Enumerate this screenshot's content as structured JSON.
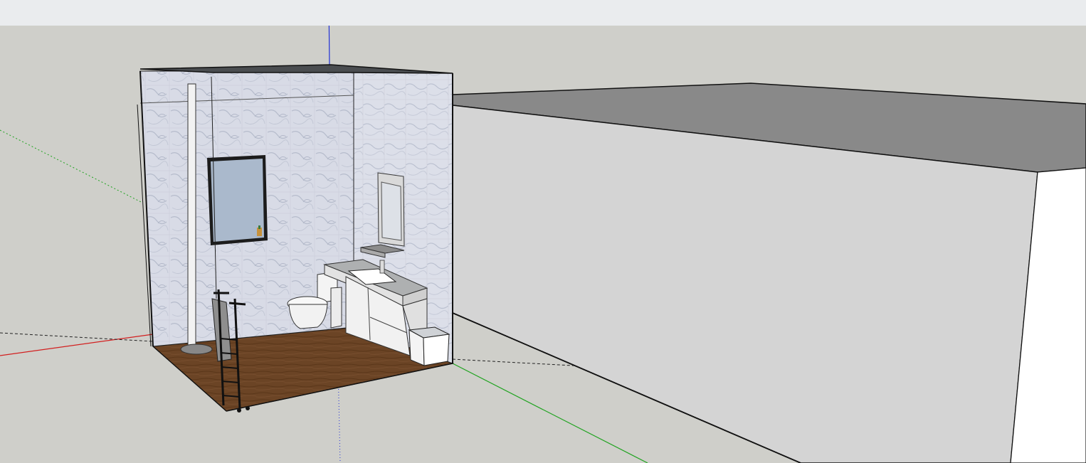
{
  "app": {
    "toolbar": {},
    "viewport": {
      "sky_color": "#cfcfca",
      "ground_color": "#cfcfca",
      "axes": {
        "red": "#d21f1f",
        "green": "#1fa31f",
        "blue": "#2232d6"
      },
      "scene": {
        "room": "bathroom",
        "objects": [
          "shower-pole-icon",
          "window-icon",
          "toilet-icon",
          "vanity-cabinet-icon",
          "sink-icon",
          "faucet-icon",
          "mirror-icon",
          "shelf-icon",
          "towel-rack-icon",
          "trash-bin-icon",
          "floor-icon",
          "building-box-icon"
        ]
      }
    }
  }
}
